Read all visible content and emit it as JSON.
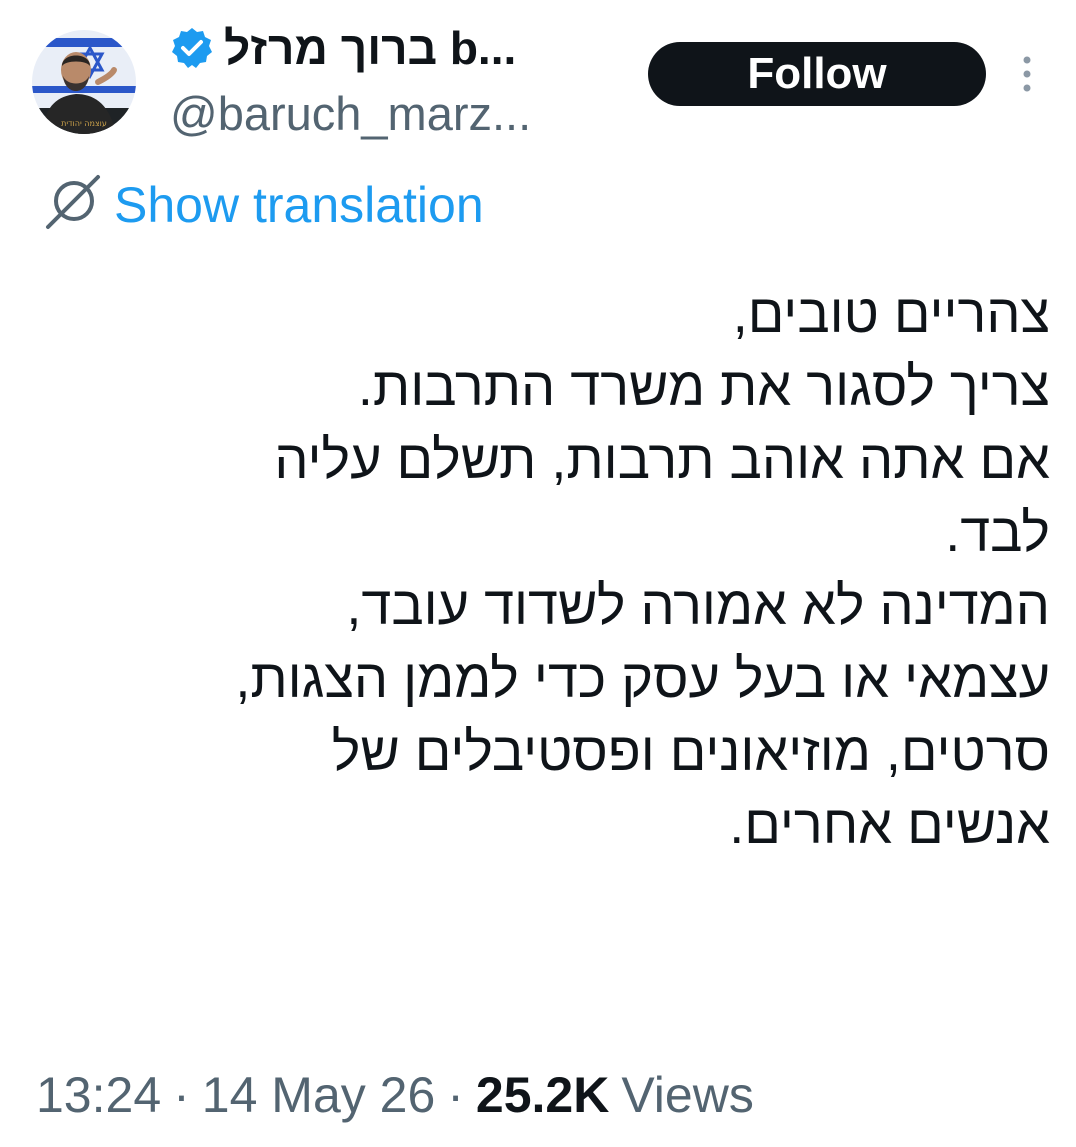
{
  "tweet": {
    "author": {
      "display_name": "ברוך מרזל b...",
      "handle": "@baruch_marz...",
      "verified": true,
      "avatar_icon": "avatar-photo-icon"
    },
    "follow_label": "Follow",
    "translation_label": "Show translation",
    "lines": [
      "צהריים טובים,",
      "צריך לסגור את משרד התרבות.",
      "אם אתה אוהב תרבות, תשלם עליה",
      "לבד.",
      "המדינה לא אמורה לשדוד עובד,",
      "עצמאי או בעל עסק כדי לממן הצגות,",
      "סרטים, מוזיאונים ופסטיבלים של",
      "אנשים אחרים."
    ],
    "time": "13:24",
    "separator": "·",
    "date": "14 May 26",
    "views_count": "25.2K",
    "views_label": "Views"
  },
  "colors": {
    "text": "#0f1419",
    "secondary": "#536471",
    "link": "#1d9bf0",
    "verified": "#1d9bf0",
    "follow_bg": "#0f1419"
  }
}
